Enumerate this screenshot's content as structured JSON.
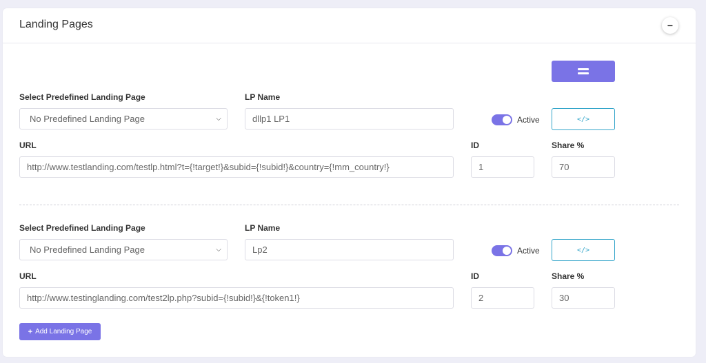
{
  "panel": {
    "title": "Landing Pages",
    "collapse_symbol": "−"
  },
  "labels": {
    "predefined": "Select Predefined Landing Page",
    "lp_name": "LP Name",
    "url": "URL",
    "id": "ID",
    "share": "Share %",
    "active": "Active"
  },
  "landing_pages": [
    {
      "predefined": "No Predefined Landing Page",
      "lp_name": "dllp1 LP1",
      "active": true,
      "url": "http://www.testlanding.com/testlp.html?t={!target!}&subid={!subid!}&country={!mm_country!}",
      "id": "1",
      "share": "70"
    },
    {
      "predefined": "No Predefined Landing Page",
      "lp_name": "Lp2",
      "active": true,
      "url": "http://www.testinglanding.com/test2lp.php?subid={!subid!}&{!token1!}",
      "id": "2",
      "share": "30"
    }
  ],
  "code_button_symbol": "</>",
  "add_button": {
    "icon": "+",
    "label": "Add Landing Page"
  },
  "icons": {
    "drag": "drag-handle-icon",
    "code": "code-icon",
    "chevron": "chevron-down-icon",
    "plus": "plus-icon"
  },
  "colors": {
    "accent": "#7a73e6",
    "code_button": "#31a4c9",
    "background": "#eeeef7"
  }
}
